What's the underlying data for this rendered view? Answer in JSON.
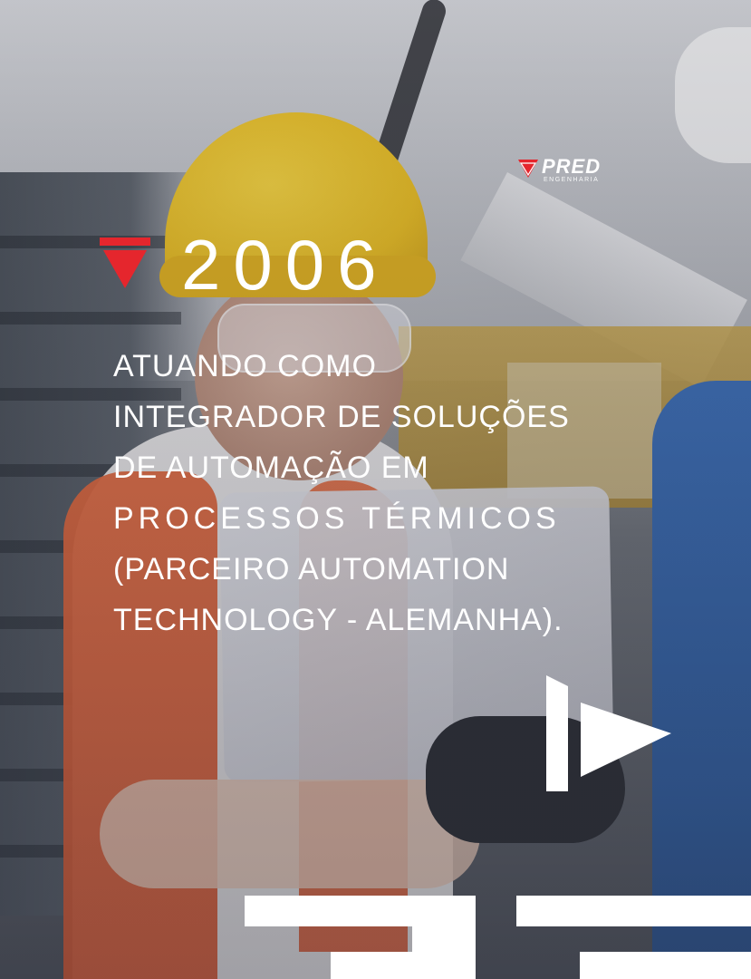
{
  "brand": {
    "logo_word": "PRED",
    "logo_sub": "ENGENHARIA",
    "accent": "#e5262d"
  },
  "milestone": {
    "year": "2006",
    "description_lines": [
      "ATUANDO COMO",
      "INTEGRADOR DE SOLUÇÕES",
      "DE AUTOMAÇÃO EM",
      "PROCESSOS TÉRMICOS",
      "(PARCEIRO AUTOMATION",
      "TECHNOLOGY - ALEMANHA)."
    ]
  },
  "icons": {
    "year_marker": "red-triangle-icon",
    "skip": "skip-forward-icon",
    "brand_watermark": "brand-shape-icon"
  }
}
